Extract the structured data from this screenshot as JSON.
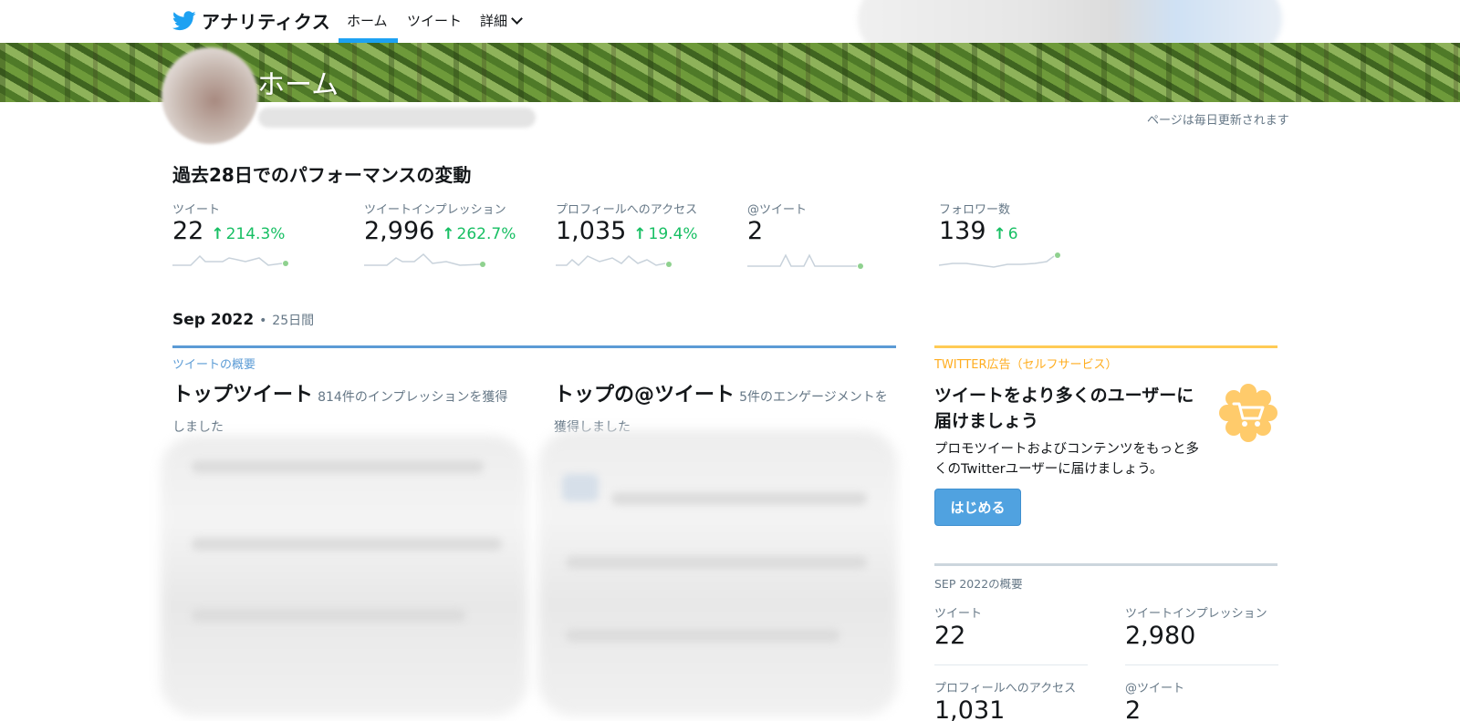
{
  "app": {
    "name": "アナリティクス",
    "logo_icon": "twitter-bird-icon",
    "accent_color": "#1da1f2"
  },
  "nav": {
    "tabs": [
      {
        "label": "ホーム",
        "active": true
      },
      {
        "label": "ツイート",
        "active": false
      },
      {
        "label": "詳細",
        "active": false,
        "icon": "chevron-down-icon"
      }
    ]
  },
  "header": {
    "title": "ホーム",
    "update_note": "ページは毎日更新されます"
  },
  "performance": {
    "title": "過去28日でのパフォーマンスの変動",
    "metrics": [
      {
        "label": "ツイート",
        "value": "22",
        "change": "214.3%",
        "trend": "up"
      },
      {
        "label": "ツイートインプレッション",
        "value": "2,996",
        "change": "262.7%",
        "trend": "up"
      },
      {
        "label": "プロフィールへのアクセス",
        "value": "1,035",
        "change": "19.4%",
        "trend": "up"
      },
      {
        "label": "@ツイート",
        "value": "2",
        "change": "",
        "trend": "none"
      },
      {
        "label": "フォロワー数",
        "value": "139",
        "change": "6",
        "trend": "up"
      }
    ],
    "positive_color": "#17bf63"
  },
  "month": {
    "title": "Sep 2022",
    "separator": "•",
    "subtitle": "25日間",
    "overview_label": "ツイートの概要",
    "top_tweet": {
      "title": "トップツイート",
      "subtitle": "814件のインプレッションを獲得しました"
    },
    "top_mention": {
      "title": "トップの@ツイート",
      "subtitle": "5件のエンゲージメントを獲得しました"
    }
  },
  "ads": {
    "label": "TWITTER広告（セルフサービス）",
    "title": "ツイートをより多くのユーザーに届けましょう",
    "body": "プロモツイートおよびコンテンツをもっと多くのTwitterユーザーに届けましょう。",
    "button": "はじめる",
    "badge_icon": "shopping-cart-icon",
    "accent_color": "#ffcb55"
  },
  "summary": {
    "label": "SEP 2022の概要",
    "items": [
      {
        "label": "ツイート",
        "value": "22"
      },
      {
        "label": "ツイートインプレッション",
        "value": "2,980"
      },
      {
        "label": "プロフィールへのアクセス",
        "value": "1,031"
      },
      {
        "label": "@ツイート",
        "value": "2"
      }
    ]
  }
}
